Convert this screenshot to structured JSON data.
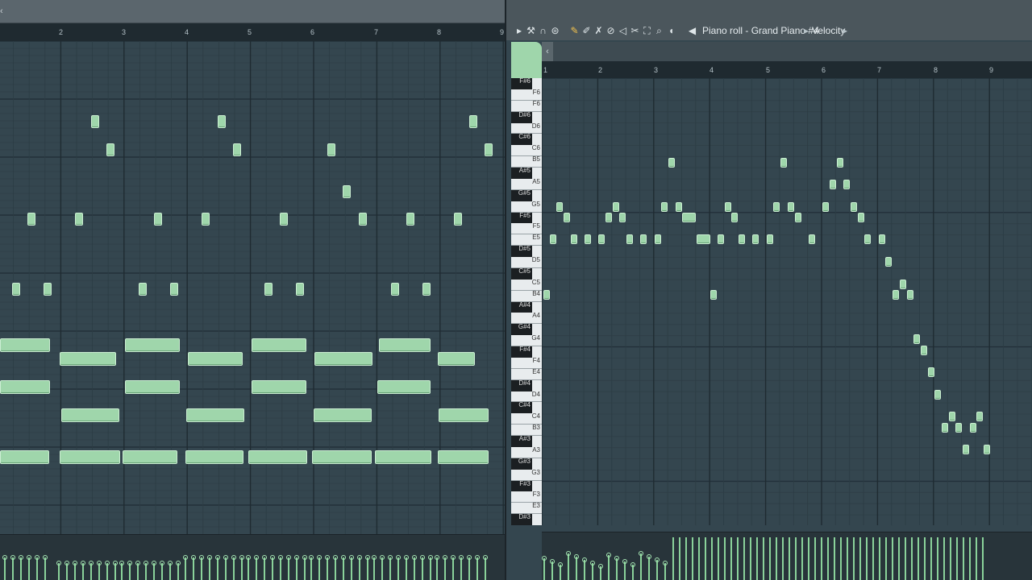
{
  "left": {
    "titlebar_arrow": "‹",
    "bar_numbers": [
      "2",
      "3",
      "4",
      "5",
      "6",
      "7",
      "8",
      "9"
    ]
  },
  "right": {
    "toolbar": {
      "menu_arrow": "▸",
      "tools": [
        "wrench-icon",
        "magnet-icon",
        "stamp-icon",
        "pencil-icon",
        "paint-icon",
        "delete-icon",
        "mute-icon",
        "slice-icon",
        "select-icon",
        "zoom-icon",
        "playback-icon"
      ],
      "breadcrumb": [
        "Piano roll - Grand Piano #4",
        "Velocity"
      ],
      "breadcrumb_sep": "▸"
    },
    "scroll_arrow": "‹",
    "bar_numbers": [
      "1",
      "2",
      "3",
      "4",
      "5",
      "6",
      "7",
      "8",
      "9"
    ],
    "keys": [
      "F#6",
      "F6",
      "F6",
      "D#6",
      "D6",
      "C#6",
      "C6",
      "B5",
      "A#5",
      "A5",
      "G#5",
      "G5",
      "F#5",
      "F5",
      "E5",
      "D#5",
      "D5",
      "C#5",
      "C5",
      "B4",
      "A#4",
      "A4",
      "G#4",
      "G4",
      "F#4",
      "F4",
      "E4",
      "D#4",
      "D4",
      "C#4",
      "C4",
      "B3",
      "A#3",
      "A3",
      "G#3",
      "G3",
      "F#3",
      "F3",
      "E3",
      "D#3"
    ]
  },
  "colors": {
    "note": "#9fd6ab",
    "background": "#34464f",
    "toolbar": "#4b565c"
  }
}
